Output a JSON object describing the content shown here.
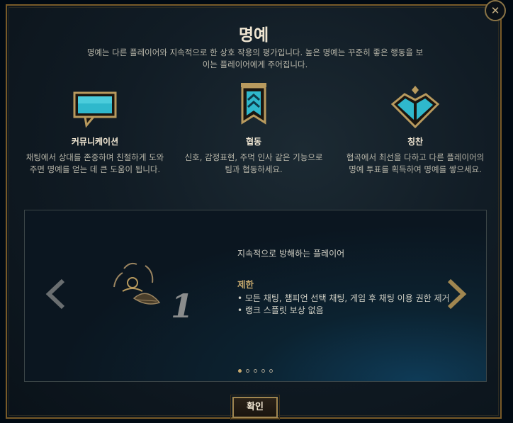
{
  "modal": {
    "title": "명예",
    "subtitle": "명예는 다른 플레이어와 지속적으로 한 상호 작용의 평가입니다. 높은 명예는 꾸준히 좋은 행동을 보이는 플레이어에게 주어집니다.",
    "close_label": "✕",
    "features": [
      {
        "name": "커뮤니케이션",
        "icon": "speech-bubble-icon",
        "desc": "채팅에서 상대를 존중하며 친절하게 도와주면 명예를 얻는 데 큰 도움이 됩니다."
      },
      {
        "name": "협동",
        "icon": "banner-icon",
        "desc": "신호, 감정표현, 주먹 인사 같은 기능으로 팀과 협동하세요."
      },
      {
        "name": "칭찬",
        "icon": "heart-crest-icon",
        "desc": "협곡에서 최선을 다하고 다른 플레이어의 명예 투표를 획득하여 명예를 쌓으세요."
      }
    ],
    "carousel": {
      "level": "1",
      "tier_label": "지속적으로 방해하는 플레이어",
      "restriction_title": "제한",
      "restrictions": [
        "• 모든 채팅, 챔피언 선택 채팅, 게임 후 채팅 이용 권한 제거",
        "• 랭크 스플릿 보상 없음"
      ],
      "page_count": 5,
      "active_page": 1
    },
    "confirm_label": "확인"
  },
  "colors": {
    "gold": "#c8aa6e",
    "border_gold": "#785a28",
    "teal": "#2ec4d6",
    "text_light": "#f0e6d2"
  }
}
